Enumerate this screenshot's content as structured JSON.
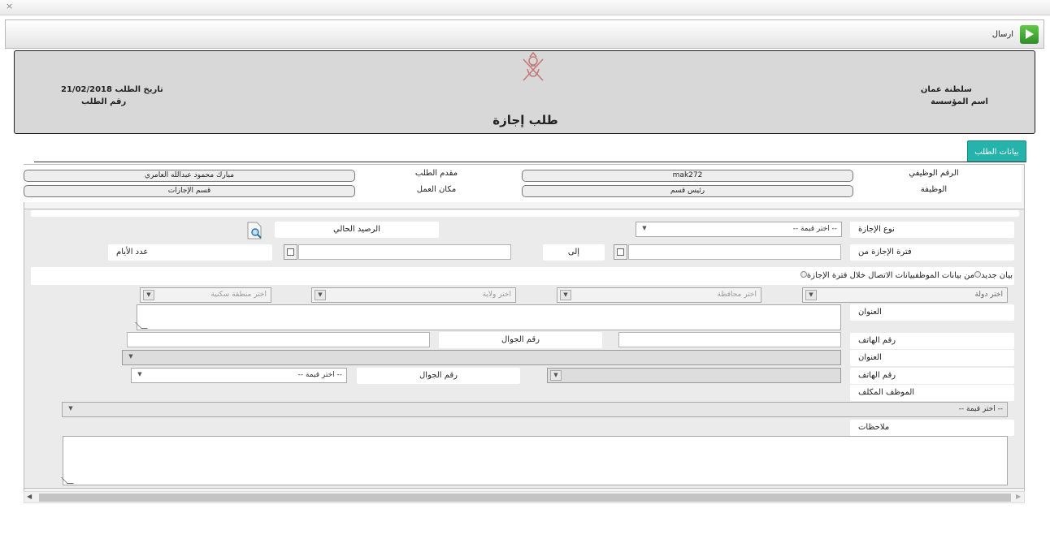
{
  "window": {
    "close_glyph": "×"
  },
  "toolbar": {
    "send_label": "ارسال",
    "send_icon": "play-icon"
  },
  "header": {
    "org_name": "سلطنة عمان",
    "institution_label": "اسم المؤسسة",
    "date_label": "تاريخ الطلب",
    "date_value": "21/02/2018",
    "request_number_label": "رقم الطلب",
    "title": "طلب إجازة",
    "emblem_icon": "oman-emblem-icon"
  },
  "tabs": [
    {
      "label": "بيانات الطلب",
      "active": true
    }
  ],
  "info": {
    "employee_id_label": "الرقم الوظيفي",
    "employee_id_value": "mak272",
    "applicant_label": "مقدم الطلب",
    "applicant_value": "مبارك محمود عبدالله العامري",
    "job_label": "الوظيفة",
    "job_value": "رئيس قسم",
    "workplace_label": "مكان العمل",
    "workplace_value": "قسم الإجازات"
  },
  "form": {
    "leave_type_label": "نوع الإجازة",
    "leave_type_value": "-- اختر قيمة --",
    "current_balance_label": "الرصيد الحالي",
    "period_from_label": "فترة الإجازة من",
    "to_label": "إلى",
    "days_count_label": "عدد الأيام",
    "contact_prefix": "بيانات الاتصال خلال فترة الإجازة",
    "contact_opt1": "من بيانات الموظف",
    "contact_opt2": "بيان جديد",
    "country_placeholder": "اختر دولة",
    "governorate_placeholder": "اختر محافظة",
    "wilayat_placeholder": "اختر ولاية",
    "area_placeholder": "اختر منطقة سكنية",
    "address_label": "العنوان",
    "phone_label": "رقم الهاتف",
    "mobile_label": "رقم الجوال",
    "address2_label": "العنوان",
    "phone2_label": "رقم الهاتف",
    "mobile2_label": "رقم الجوال",
    "mobile2_value": "-- اختر قيمة --",
    "assigned_employee_label": "الموظف المكلف",
    "assigned_employee_value": "-- اختر قيمة --",
    "notes_label": "ملاحظات"
  },
  "colors": {
    "tab_active": "#26b3ac",
    "header_bg": "#d8d8d8",
    "send_icon": "#3aa630"
  }
}
